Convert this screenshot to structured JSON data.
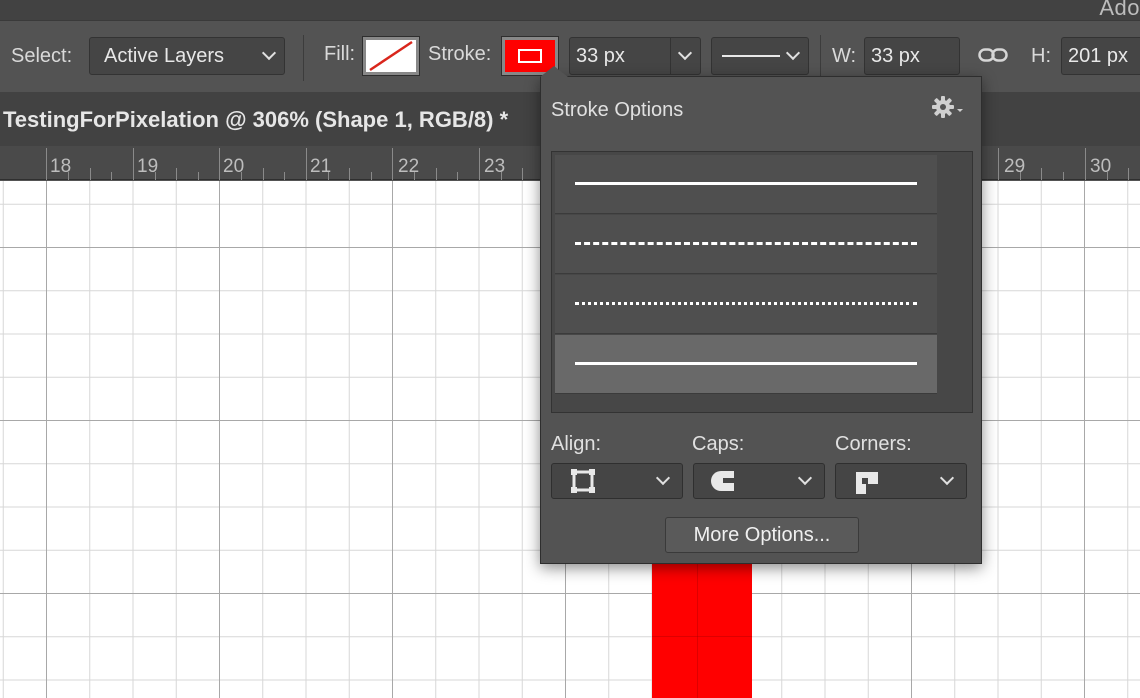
{
  "app": {
    "title_fragment": "Ado"
  },
  "options_bar": {
    "select_label": "Select:",
    "select_value": "Active Layers",
    "fill_label": "Fill:",
    "stroke_label": "Stroke:",
    "stroke_width_value": "33 px",
    "w_label": "W:",
    "w_value": "33 px",
    "h_label": "H:",
    "h_value": "201 px",
    "colors": {
      "stroke_swatch": "#ff0000",
      "fill_swatch_slash": "#d9261c"
    }
  },
  "document": {
    "tab_title": "TestingForPixelation @ 306% (Shape 1, RGB/8) *"
  },
  "ruler": {
    "ticks": [
      "18",
      "19",
      "20",
      "21",
      "22",
      "23",
      "29",
      "30"
    ]
  },
  "stroke_options": {
    "title": "Stroke Options",
    "styles": [
      {
        "kind": "solid"
      },
      {
        "kind": "dashed"
      },
      {
        "kind": "dotted"
      },
      {
        "kind": "solid",
        "selected": true
      }
    ],
    "align_label": "Align:",
    "caps_label": "Caps:",
    "corners_label": "Corners:",
    "more_options_label": "More Options..."
  },
  "canvas": {
    "shape_color": "#ff0000"
  }
}
